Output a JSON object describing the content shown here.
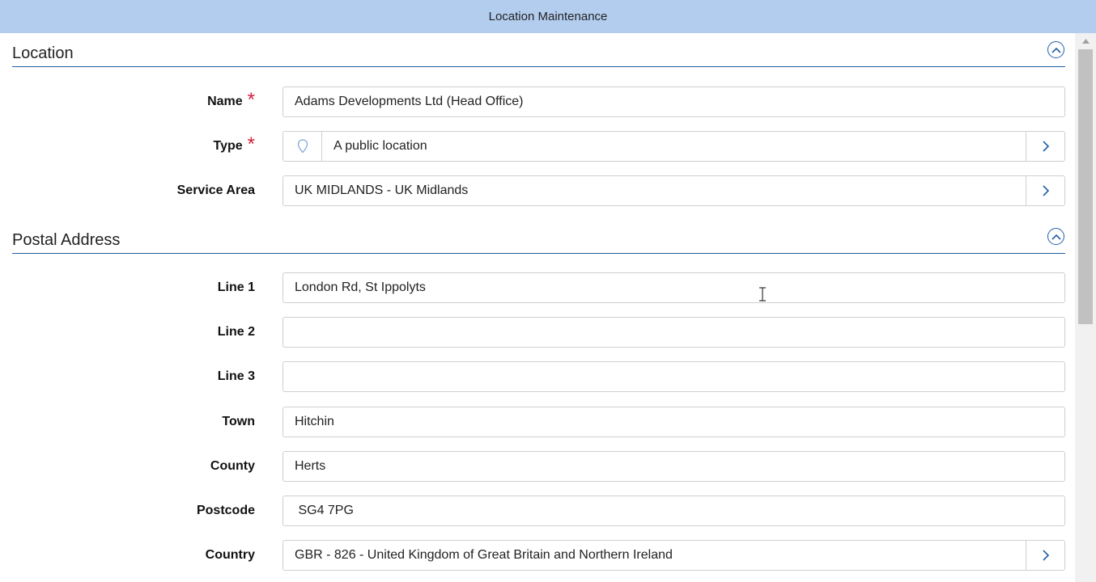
{
  "window": {
    "title": "Location Maintenance"
  },
  "sections": {
    "location": {
      "title": "Location",
      "fields": {
        "name": {
          "label": "Name",
          "value": "Adams Developments Ltd (Head Office)"
        },
        "type": {
          "label": "Type",
          "value": "A public location"
        },
        "service_area": {
          "label": "Service Area",
          "value": "UK MIDLANDS - UK Midlands"
        }
      }
    },
    "postal_address": {
      "title": "Postal Address",
      "fields": {
        "line1": {
          "label": "Line 1",
          "value": "London Rd, St Ippolyts"
        },
        "line2": {
          "label": "Line 2",
          "value": ""
        },
        "line3": {
          "label": "Line 3",
          "value": ""
        },
        "town": {
          "label": "Town",
          "value": "Hitchin"
        },
        "county": {
          "label": "County",
          "value": "Herts"
        },
        "postcode": {
          "label": "Postcode",
          "value": " SG4 7PG"
        },
        "country": {
          "label": "Country",
          "value": "GBR - 826 - United Kingdom of Great Britain and Northern Ireland"
        }
      }
    }
  },
  "required_marker": "*",
  "colors": {
    "titlebar": "#b3cdef",
    "accent": "#1f5fa8",
    "required": "#d0203a"
  }
}
